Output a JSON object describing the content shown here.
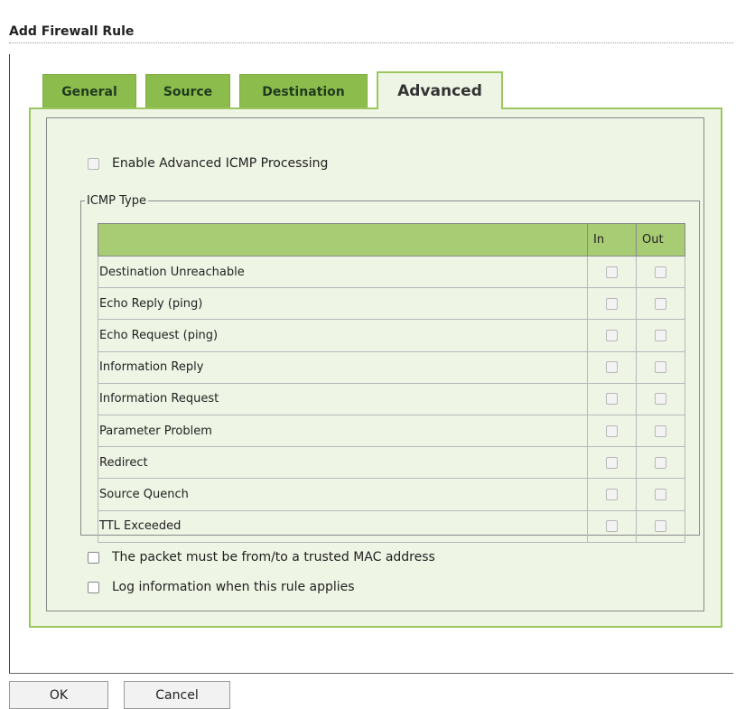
{
  "dialog": {
    "title": "Add Firewall Rule"
  },
  "tabs": [
    {
      "label": "General",
      "active": false
    },
    {
      "label": "Source",
      "active": false
    },
    {
      "label": "Destination",
      "active": false
    },
    {
      "label": "Advanced",
      "active": true
    }
  ],
  "advanced": {
    "enable_icmp_label": "Enable Advanced ICMP Processing",
    "enable_icmp_checked": false,
    "icmp_legend": "ICMP Type",
    "table": {
      "headers": [
        "",
        "In",
        "Out"
      ],
      "rows": [
        {
          "label": "Destination Unreachable",
          "in": false,
          "out": false
        },
        {
          "label": "Echo Reply (ping)",
          "in": false,
          "out": false
        },
        {
          "label": "Echo Request (ping)",
          "in": false,
          "out": false
        },
        {
          "label": "Information Reply",
          "in": false,
          "out": false
        },
        {
          "label": "Information Request",
          "in": false,
          "out": false
        },
        {
          "label": "Parameter Problem",
          "in": false,
          "out": false
        },
        {
          "label": "Redirect",
          "in": false,
          "out": false
        },
        {
          "label": "Source Quench",
          "in": false,
          "out": false
        },
        {
          "label": "TTL Exceeded",
          "in": false,
          "out": false
        }
      ]
    },
    "trusted_mac_label": "The packet must be from/to a trusted MAC address",
    "trusted_mac_checked": false,
    "log_label": "Log information when this rule applies",
    "log_checked": false
  },
  "buttons": {
    "ok": "OK",
    "cancel": "Cancel"
  },
  "colors": {
    "tab_inactive": "#8cbd4c",
    "tab_active_bg": "#eef5e4",
    "panel_border": "#9bc75e",
    "table_header": "#a8cc74"
  }
}
